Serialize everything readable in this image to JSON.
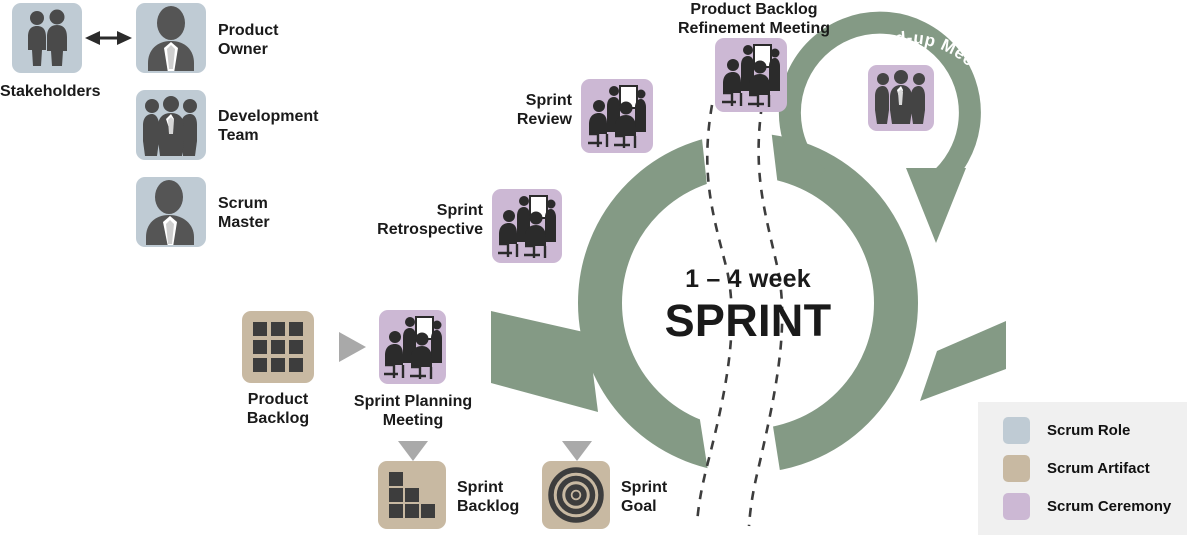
{
  "diagram": {
    "title_center_top": "1 – 4 week",
    "title_center_main": "SPRINT",
    "daily_standup_label": "Daily Stand-up Meeting"
  },
  "roles": {
    "stakeholders": {
      "label": "Stakeholders",
      "icon": "two-people-icon",
      "color": "#bfcbd4"
    },
    "product_owner": {
      "label": "Product\nOwner",
      "icon": "person-suit-icon",
      "color": "#bfcbd4"
    },
    "development_team": {
      "label": "Development\nTeam",
      "icon": "three-people-icon",
      "color": "#bfcbd4"
    },
    "scrum_master": {
      "label": "Scrum\nMaster",
      "icon": "person-suit-icon",
      "color": "#bfcbd4"
    }
  },
  "artifacts": {
    "product_backlog": {
      "label": "Product\nBacklog",
      "icon": "grid-squares-icon",
      "color": "#c8b9a2"
    },
    "sprint_backlog": {
      "label": "Sprint\nBacklog",
      "icon": "stair-squares-icon",
      "color": "#c8b9a2"
    },
    "sprint_goal": {
      "label": "Sprint\nGoal",
      "icon": "target-icon",
      "color": "#c8b9a2"
    }
  },
  "ceremonies": {
    "sprint_planning": {
      "label": "Sprint Planning\nMeeting",
      "icon": "meeting-icon",
      "color": "#ccb8d4"
    },
    "sprint_retrospective": {
      "label": "Sprint\nRetrospective",
      "icon": "meeting-icon",
      "color": "#ccb8d4"
    },
    "sprint_review": {
      "label": "Sprint\nReview",
      "icon": "meeting-icon",
      "color": "#ccb8d4"
    },
    "backlog_refinement": {
      "label": "Product Backlog\nRefinement Meeting",
      "icon": "meeting-icon",
      "color": "#ccb8d4"
    },
    "daily_standup": {
      "label": "Daily Stand-up Meeting",
      "icon": "standing-people-icon",
      "color": "#ccb8d4"
    }
  },
  "legend": {
    "items": [
      {
        "label": "Scrum Role",
        "color": "#bfcbd4"
      },
      {
        "label": "Scrum Artifact",
        "color": "#c8b9a2"
      },
      {
        "label": "Scrum Ceremony",
        "color": "#ccb8d4"
      }
    ]
  },
  "colors": {
    "green": "#849a85",
    "dark": "#3d3d3d",
    "gray_arrow": "#a9a9a9",
    "legend_bg": "#f0f0f0",
    "page_bg": "#ffffff"
  }
}
